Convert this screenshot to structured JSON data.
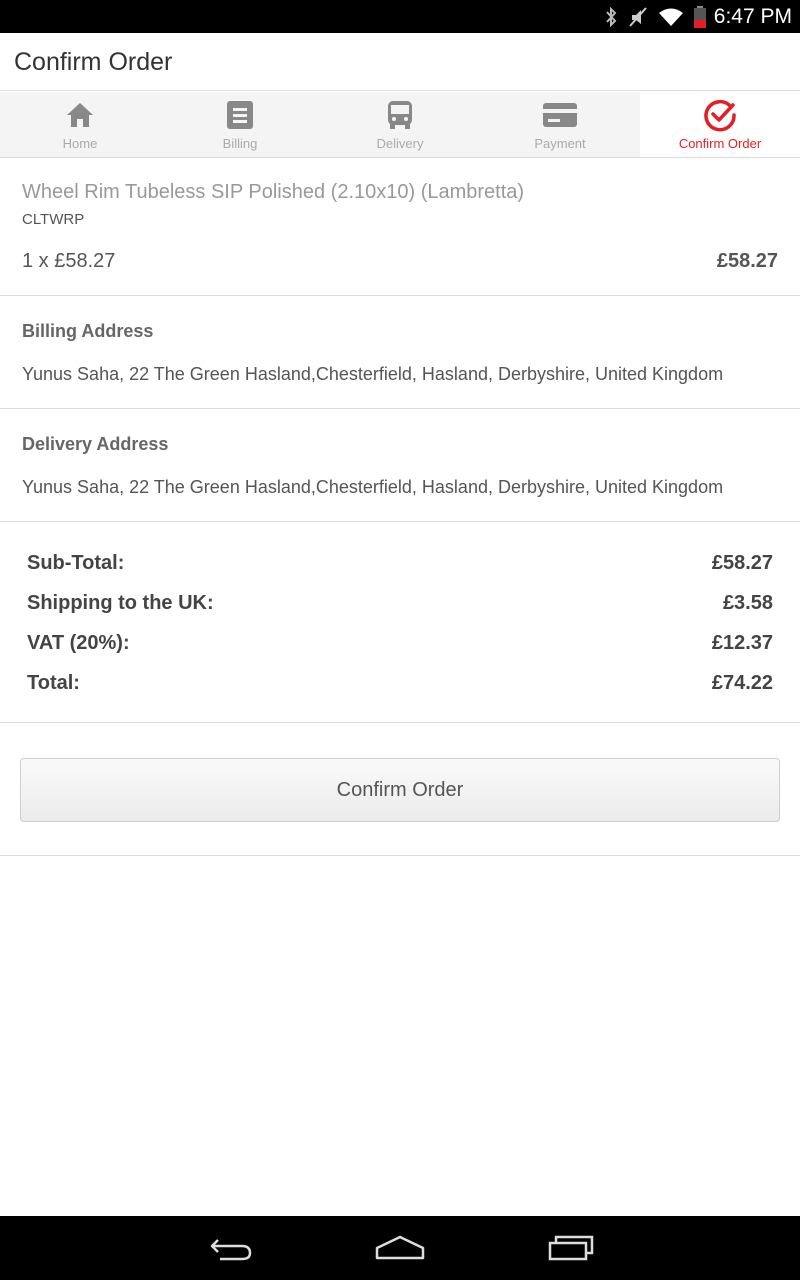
{
  "status_bar": {
    "time": "6:47 PM",
    "icons": [
      "bluetooth-icon",
      "mute-icon",
      "wifi-icon",
      "battery-icon"
    ]
  },
  "header": {
    "title": "Confirm Order"
  },
  "tabs": [
    {
      "label": "Home",
      "icon": "home-icon",
      "active": false
    },
    {
      "label": "Billing",
      "icon": "billing-icon",
      "active": false
    },
    {
      "label": "Delivery",
      "icon": "bus-icon",
      "active": false
    },
    {
      "label": "Payment",
      "icon": "card-icon",
      "active": false
    },
    {
      "label": "Confirm Order",
      "icon": "check-circle-icon",
      "active": true
    }
  ],
  "product": {
    "name": "Wheel Rim Tubeless SIP Polished (2.10x10) (Lambretta)",
    "sku": "CLTWRP",
    "quantity_price": "1 x £58.27",
    "line_total": "£58.27"
  },
  "billing": {
    "heading": "Billing Address",
    "address": "Yunus Saha, 22 The Green Hasland,Chesterfield, Hasland, Derbyshire, United Kingdom"
  },
  "delivery": {
    "heading": "Delivery Address",
    "address": "Yunus Saha, 22 The Green Hasland,Chesterfield, Hasland, Derbyshire, United Kingdom"
  },
  "totals": [
    {
      "label": "Sub-Total:",
      "value": "£58.27"
    },
    {
      "label": "Shipping to the UK:",
      "value": "£3.58"
    },
    {
      "label": "VAT (20%):",
      "value": "£12.37"
    },
    {
      "label": "Total:",
      "value": "£74.22"
    }
  ],
  "confirm_button": {
    "label": "Confirm Order"
  },
  "colors": {
    "accent": "#e31e24",
    "status_bar": "#000000",
    "nav_bar": "#000000"
  },
  "nav_bar": [
    "back-icon",
    "home-nav-icon",
    "recents-icon"
  ]
}
